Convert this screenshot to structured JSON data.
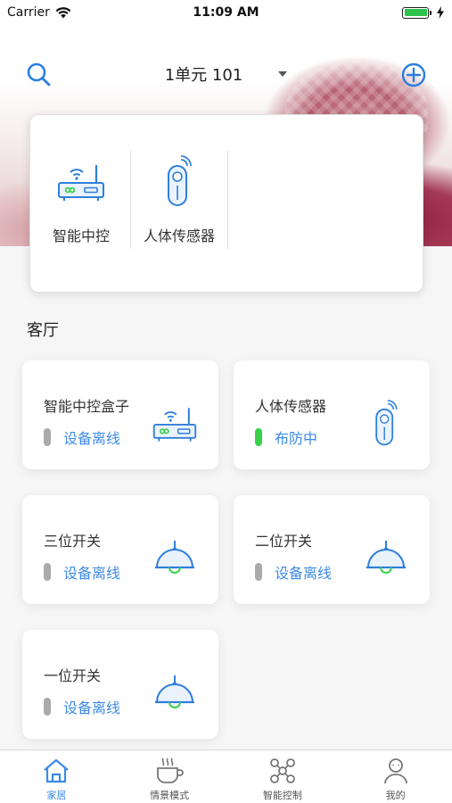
{
  "status_bar": {
    "carrier": "Carrier",
    "time": "11:09 AM"
  },
  "header": {
    "home_name": "1单元 101",
    "search_icon": "search-icon",
    "add_icon": "plus-circle-icon"
  },
  "quick_devices": [
    {
      "label": "智能中控",
      "icon": "router-icon"
    },
    {
      "label": "人体传感器",
      "icon": "motion-sensor-icon"
    }
  ],
  "room": {
    "title": "客厅",
    "devices": [
      {
        "name": "智能中控盒子",
        "status": "设备离线",
        "online": false,
        "icon": "router-icon"
      },
      {
        "name": "人体传感器",
        "status": "布防中",
        "online": true,
        "icon": "motion-sensor-icon"
      },
      {
        "name": "三位开关",
        "status": "设备离线",
        "online": false,
        "icon": "lamp-icon"
      },
      {
        "name": "二位开关",
        "status": "设备离线",
        "online": false,
        "icon": "lamp-icon"
      },
      {
        "name": "一位开关",
        "status": "设备离线",
        "online": false,
        "icon": "lamp-icon"
      }
    ]
  },
  "tabs": [
    {
      "label": "家居",
      "icon": "home-icon",
      "active": true
    },
    {
      "label": "情景模式",
      "icon": "coffee-icon",
      "active": false
    },
    {
      "label": "智能控制",
      "icon": "network-icon",
      "active": false
    },
    {
      "label": "我的",
      "icon": "user-icon",
      "active": false
    }
  ],
  "colors": {
    "accent": "#3d8ae6",
    "online": "#3ad14a",
    "offline": "#aaaaaa"
  }
}
